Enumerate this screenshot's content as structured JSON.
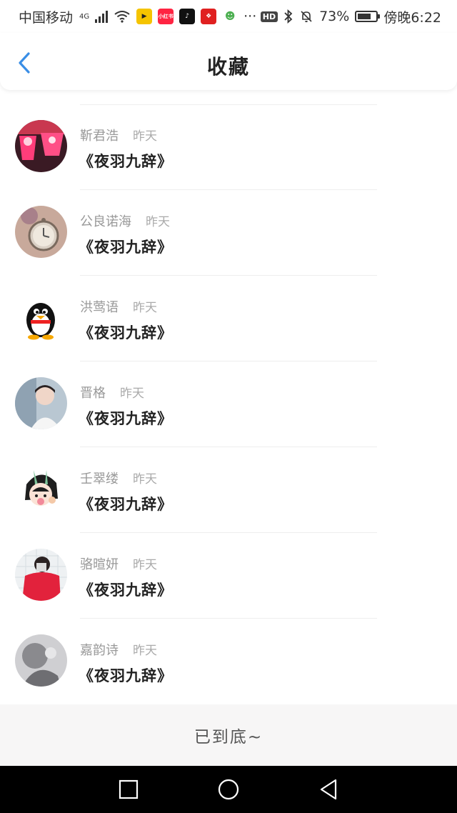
{
  "status_bar": {
    "carrier": "中国移动",
    "network": "4G",
    "battery_text": "73%",
    "battery_level": 0.73,
    "time": "傍晚6:22",
    "hd": "HD",
    "app_icons": [
      "video-app-icon",
      "xiaohongshu-icon",
      "tiktok-icon",
      "dots-app-icon",
      "bird-app-icon"
    ],
    "xiaohongshu_label": "小红书",
    "more": "···"
  },
  "header": {
    "title": "收藏"
  },
  "favorites": [
    {
      "name": "靳君浩",
      "time": "昨天",
      "work": "《夜羽九辞》"
    },
    {
      "name": "公良诺海",
      "time": "昨天",
      "work": "《夜羽九辞》"
    },
    {
      "name": "洪莺语",
      "time": "昨天",
      "work": "《夜羽九辞》"
    },
    {
      "name": "晋格",
      "time": "昨天",
      "work": "《夜羽九辞》"
    },
    {
      "name": "壬翠缕",
      "time": "昨天",
      "work": "《夜羽九辞》"
    },
    {
      "name": "骆暄妍",
      "time": "昨天",
      "work": "《夜羽九辞》"
    },
    {
      "name": "嘉韵诗",
      "time": "昨天",
      "work": "《夜羽九辞》"
    }
  ],
  "footer": {
    "end_text": "已到底~"
  },
  "colors": {
    "accent": "#3a8ee6",
    "name_gray": "#999999",
    "footer_bg": "#f7f6f6"
  }
}
